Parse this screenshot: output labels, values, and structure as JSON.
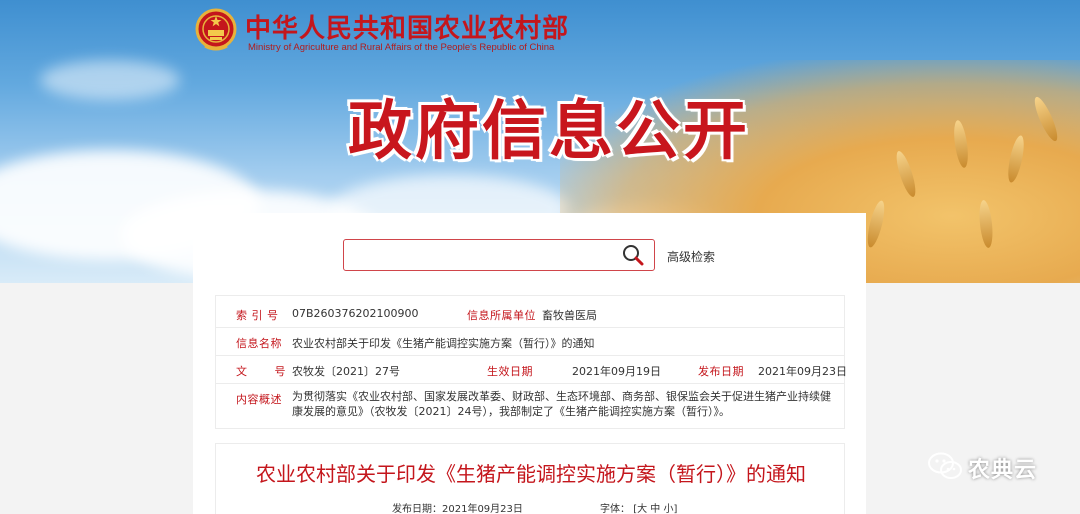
{
  "header": {
    "ministry_cn": "中华人民共和国农业农村部",
    "ministry_en": "Ministry of Agriculture and Rural Affairs of the People's Republic of China",
    "page_title": "政府信息公开"
  },
  "search": {
    "value": "",
    "placeholder": "",
    "advanced_label": "高级检索"
  },
  "info": {
    "index_label": "索 引 号",
    "index_value": "07B260376202100900",
    "owner_label": "信息所属单位",
    "owner_value": "畜牧兽医局",
    "name_label": "信息名称",
    "name_value": "农业农村部关于印发《生猪产能调控实施方案（暂行）》的通知",
    "doc_label": "文 号",
    "doc_value": "农牧发〔2021〕27号",
    "effective_label": "生效日期",
    "effective_value": "2021年09月19日",
    "published_label": "发布日期",
    "published_value": "2021年09月23日",
    "summary_label": "内容概述",
    "summary_value": "为贯彻落实《农业农村部、国家发展改革委、财政部、生态环境部、商务部、银保监会关于促进生猪产业持续健康发展的意见》（农牧发〔2021〕24号），我部制定了《生猪产能调控实施方案（暂行）》。"
  },
  "article": {
    "title": "农业农村部关于印发《生猪产能调控实施方案（暂行）》的通知",
    "date_label": "发布日期：",
    "date_value": "2021年09月23日",
    "font_label": "字体：",
    "font_open": "[",
    "font_large": "大",
    "font_medium": "中",
    "font_small": "小",
    "font_close": "]"
  },
  "watermark": {
    "text": "农典云"
  },
  "colors": {
    "brand_red": "#c4161c"
  }
}
